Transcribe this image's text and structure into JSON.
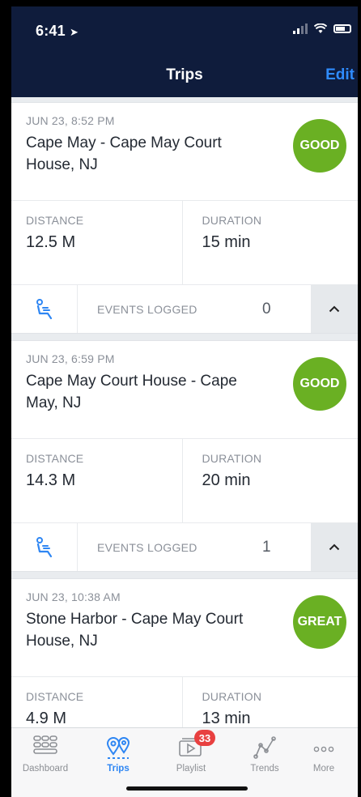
{
  "status_bar": {
    "time": "6:41"
  },
  "header": {
    "title": "Trips",
    "edit_label": "Edit"
  },
  "trips": [
    {
      "date": "JUN 23, 8:52 PM",
      "route": "Cape May - Cape May Court House, NJ",
      "rating": "GOOD",
      "distance_label": "DISTANCE",
      "distance": "12.5 M",
      "duration_label": "DURATION",
      "duration": "15 min",
      "events_label": "EVENTS LOGGED",
      "events_count": "0"
    },
    {
      "date": "JUN 23, 6:59 PM",
      "route": "Cape May Court House - Cape May, NJ",
      "rating": "GOOD",
      "distance_label": "DISTANCE",
      "distance": "14.3 M",
      "duration_label": "DURATION",
      "duration": "20 min",
      "events_label": "EVENTS LOGGED",
      "events_count": "1"
    },
    {
      "date": "JUN 23, 10:38 AM",
      "route": "Stone Harbor - Cape May Court House, NJ",
      "rating": "GREAT",
      "distance_label": "DISTANCE",
      "distance": "4.9 M",
      "duration_label": "DURATION",
      "duration": "13 min"
    }
  ],
  "tabs": [
    {
      "label": "Dashboard",
      "icon": "dashboard-grid-icon"
    },
    {
      "label": "Trips",
      "icon": "trips-pins-icon",
      "active": true
    },
    {
      "label": "Playlist",
      "icon": "playlist-video-icon",
      "badge": "33"
    },
    {
      "label": "Trends",
      "icon": "trends-graph-icon"
    },
    {
      "label": "More",
      "icon": "more-dots-icon"
    }
  ],
  "colors": {
    "header_bg": "#0f1c3c",
    "accent": "#2f8cff",
    "rating_green": "#6ab023",
    "badge_red": "#e84040"
  }
}
